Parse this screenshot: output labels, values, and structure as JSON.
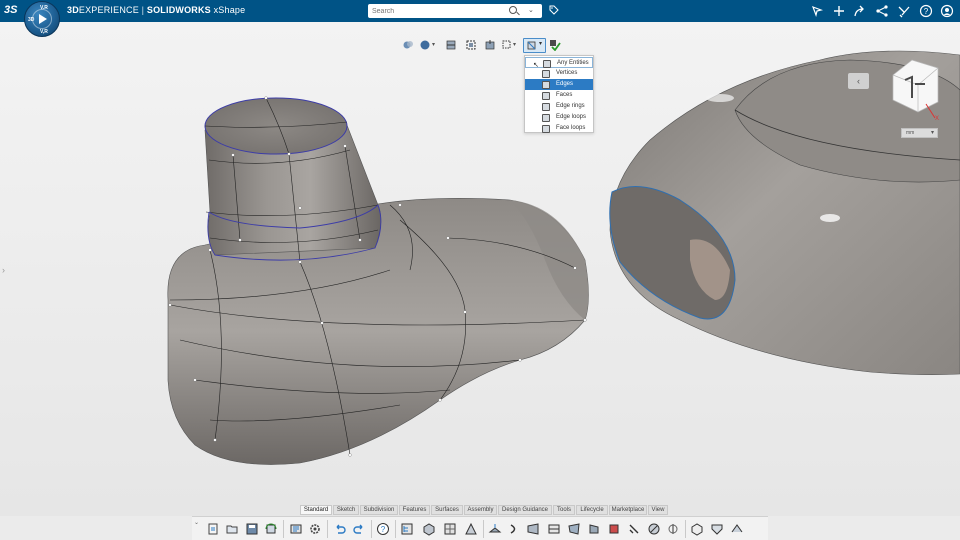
{
  "app": {
    "brand_3d": "3D",
    "brand_experience": "EXPERIENCE",
    "brand_separator": "|",
    "brand_solidworks": "SOLIDWORKS",
    "brand_product": "xShape",
    "logo_text": "3S",
    "compass_labels": {
      "top": "V.R",
      "left": "3D",
      "bottom": "V,R"
    }
  },
  "search": {
    "placeholder": "Search",
    "value": ""
  },
  "header_icons": [
    "tag-icon",
    "compass-icon",
    "plus-icon",
    "share-icon",
    "network-icon",
    "tools-icon",
    "help-icon",
    "user-icon"
  ],
  "selection_filter": {
    "items": [
      {
        "label": "Any Entities",
        "icon": "any-entities-icon"
      },
      {
        "label": "Vertices",
        "icon": "vertices-icon"
      },
      {
        "label": "Edges",
        "icon": "edges-icon",
        "highlighted": true
      },
      {
        "label": "Faces",
        "icon": "faces-icon"
      },
      {
        "label": "Edge rings",
        "icon": "edge-rings-icon"
      },
      {
        "label": "Edge loops",
        "icon": "edge-loops-icon"
      },
      {
        "label": "Face loops",
        "icon": "face-loops-icon"
      }
    ]
  },
  "view_widget": {
    "unit": "mm"
  },
  "tabs": [
    {
      "label": "Standard",
      "active": true
    },
    {
      "label": "Sketch"
    },
    {
      "label": "Subdivision"
    },
    {
      "label": "Features"
    },
    {
      "label": "Surfaces"
    },
    {
      "label": "Assembly"
    },
    {
      "label": "Design Guidance"
    },
    {
      "label": "Tools"
    },
    {
      "label": "Lifecycle"
    },
    {
      "label": "Marketplace"
    },
    {
      "label": "View"
    }
  ],
  "colors": {
    "header": "#005386",
    "accent": "#2c7bc4",
    "model": "#8a8581",
    "edge_highlight": "#3c3ca8"
  }
}
